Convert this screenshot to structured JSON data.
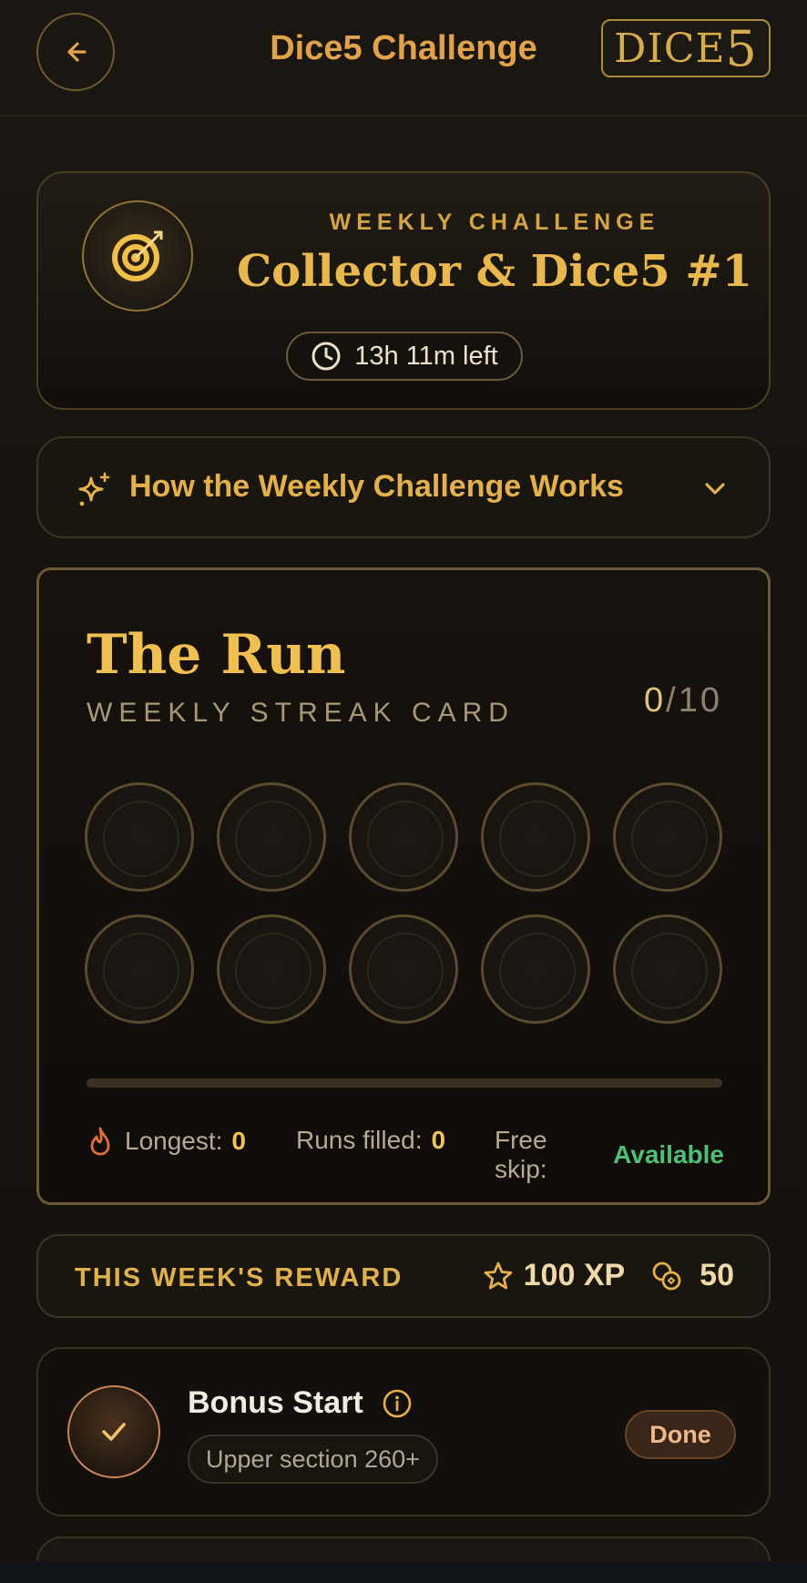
{
  "header": {
    "title": "Dice5 Challenge",
    "logo_text": "DICE",
    "logo_digit": "5",
    "back_icon": "arrow-left-icon"
  },
  "challenge": {
    "icon": "target-icon",
    "label": "WEEKLY CHALLENGE",
    "title": "Collector & Dice5 #1",
    "time_left": "13h 11m left",
    "time_icon": "clock-icon"
  },
  "how_it_works": {
    "label": "How the Weekly Challenge Works",
    "icon": "sparkles-icon",
    "chevron_icon": "chevron-down-icon"
  },
  "run": {
    "title": "The Run",
    "subtitle": "WEEKLY STREAK CARD",
    "current": "0",
    "total": "/10",
    "slots_filled": 0,
    "slots_total": 10,
    "progress": 0,
    "stats": {
      "longest_label": "Longest:",
      "longest_value": "0",
      "runs_label": "Runs filled:",
      "runs_value": "0",
      "skip_label": "Free skip:",
      "skip_value": "Available"
    }
  },
  "reward": {
    "label": "THIS WEEK'S REWARD",
    "xp": "100 XP",
    "coins": "50"
  },
  "bonus": {
    "title": "Bonus Start",
    "requirement": "Upper section 260+",
    "status": "Done"
  },
  "colors": {
    "accent_gold": "#e0a24a",
    "success_green": "#4fbf74",
    "streak_flame": "#e0703a"
  }
}
